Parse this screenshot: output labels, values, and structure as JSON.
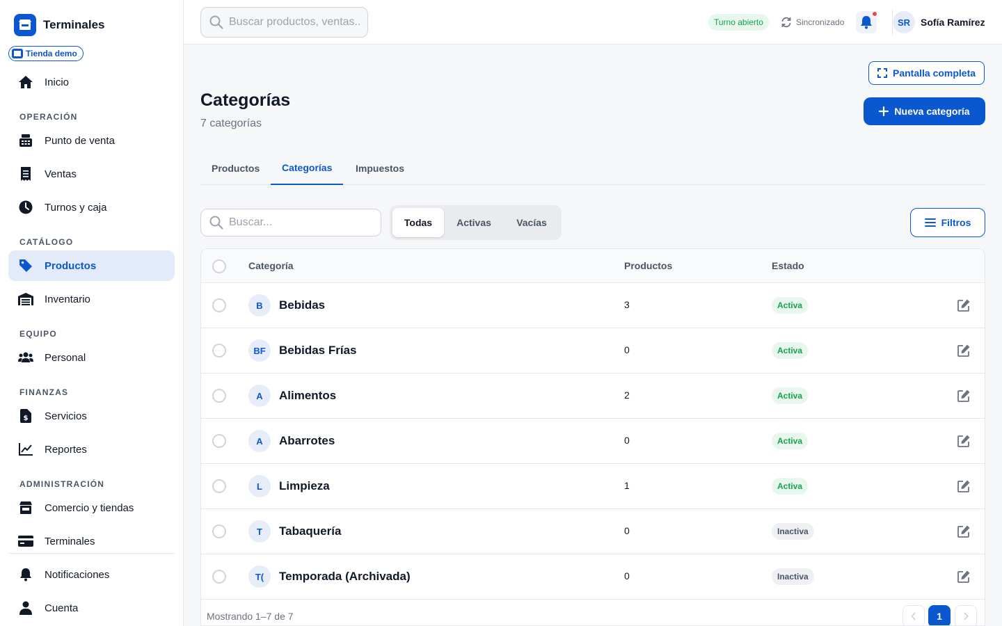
{
  "brand": {
    "name": "Terminales",
    "store": "Tienda demo"
  },
  "nav": {
    "home": "Inicio",
    "sections": {
      "operacion": "OPERACIÓN",
      "catalogo": "CATÁLOGO",
      "equipo": "EQUIPO",
      "finanzas": "FINANZAS",
      "administracion": "ADMINISTRACIÓN"
    },
    "items": {
      "pos": "Punto de venta",
      "ventas": "Ventas",
      "turnos": "Turnos y caja",
      "productos": "Productos",
      "inventario": "Inventario",
      "personal": "Personal",
      "servicios": "Servicios",
      "reportes": "Reportes",
      "comercio": "Comercio y tiendas",
      "terminales": "Terminales",
      "notificaciones": "Notificaciones",
      "cuenta": "Cuenta"
    },
    "active": "Productos"
  },
  "topbar": {
    "search_placeholder": "Buscar productos, ventas...",
    "shift_status": "Turno abierto",
    "sync_status": "Sincronizado",
    "user_initials": "SR",
    "user_name": "Sofía Ramírez"
  },
  "page": {
    "fullscreen_label": "Pantalla completa",
    "title": "Categorías",
    "subtitle": "7 categorías",
    "new_button": "Nueva categoría",
    "tabs": [
      "Productos",
      "Categorías",
      "Impuestos"
    ],
    "active_tab": "Categorías",
    "search_placeholder": "Buscar...",
    "segments": [
      "Todas",
      "Activas",
      "Vacías"
    ],
    "active_segment": "Todas",
    "filters_label": "Filtros"
  },
  "table": {
    "columns": {
      "category": "Categoría",
      "products": "Productos",
      "status": "Estado"
    },
    "rows": [
      {
        "initials": "B",
        "name": "Bebidas",
        "products": "3",
        "status": "Activa"
      },
      {
        "initials": "BF",
        "name": "Bebidas Frías",
        "products": "0",
        "status": "Activa"
      },
      {
        "initials": "A",
        "name": "Alimentos",
        "products": "2",
        "status": "Activa"
      },
      {
        "initials": "A",
        "name": "Abarrotes",
        "products": "0",
        "status": "Activa"
      },
      {
        "initials": "L",
        "name": "Limpieza",
        "products": "1",
        "status": "Activa"
      },
      {
        "initials": "T",
        "name": "Tabaquería",
        "products": "0",
        "status": "Inactiva"
      },
      {
        "initials": "T(",
        "name": "Temporada (Archivada)",
        "products": "0",
        "status": "Inactiva"
      }
    ],
    "footer": "Mostrando 1–7 de 7",
    "current_page": "1"
  },
  "colors": {
    "primary": "#0b57d0",
    "active_status_bg": "#e7f7ee",
    "active_status_text": "#16a34a",
    "inactive_status_bg": "#eef0f3",
    "notification_dot": "#ef4444"
  }
}
